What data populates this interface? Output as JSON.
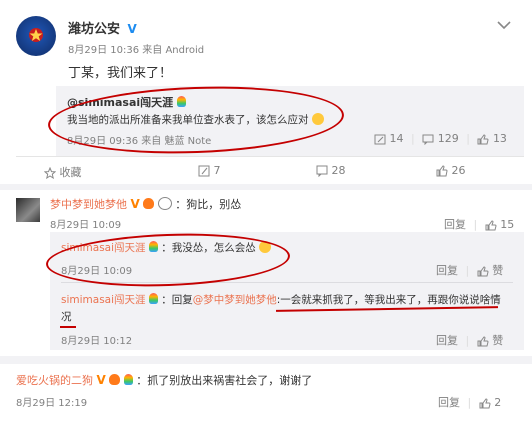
{
  "post": {
    "author": "潍坊公安",
    "verified_mark": "V",
    "meta": "8月29日 10:36 来自 Android",
    "text": "丁某，我们来了！",
    "quoted": {
      "author": "@simimasai闯天涯",
      "text": "我当地的派出所准备来我单位查水表了，该怎么应对",
      "meta": "8月29日 09:36 来自 魅蓝 Note",
      "reposts": "14",
      "comments": "129",
      "likes": "13"
    },
    "actions": {
      "favorite": "收藏",
      "repost": "7",
      "comment": "28",
      "like": "26"
    }
  },
  "comments": [
    {
      "author": "梦中梦到她梦他",
      "text": "：狗比，别怂",
      "time": "8月29日 10:09",
      "reply": "回复",
      "likes": "15"
    },
    {
      "author": "simimasai闯天涯",
      "text": "：我没怂，怎么会怂",
      "time": "8月29日 10:09",
      "reply": "回复",
      "likes": "赞"
    },
    {
      "author": "simimasai闯天涯",
      "reply_word": "：回复",
      "mention": "@梦中梦到她梦他",
      "text_line1": ":一会就来抓我了，等我出来了，再跟你说说啥情",
      "text_line2": "况",
      "time": "8月29日 10:12",
      "reply": "回复",
      "likes": "赞"
    },
    {
      "author": "爱吃火锅的二狗",
      "text": "：抓了别放出来祸害社会了，谢谢了",
      "time": "8月29日 12:19",
      "reply": "回复",
      "likes": "2"
    }
  ],
  "colors": {
    "accent_orange": "#eb7350",
    "verified_orange": "#ff8200",
    "annotation_red": "#c40000",
    "gray_text": "#808080"
  }
}
